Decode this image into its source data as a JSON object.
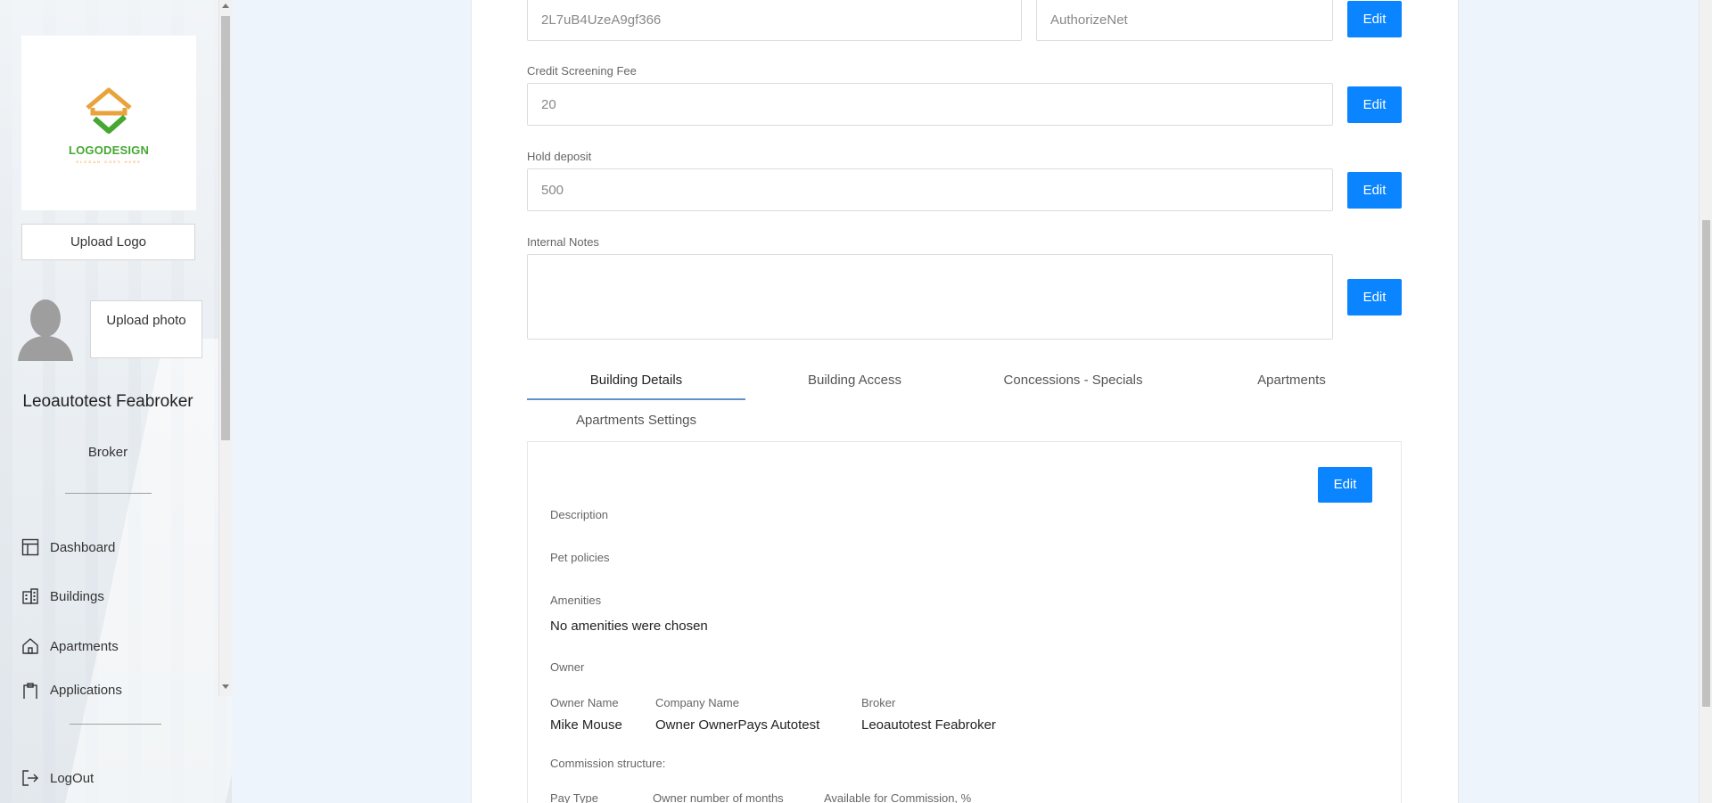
{
  "sidebar": {
    "logo_title": "LOGODESIGN",
    "logo_slogan": "SLOGAN GOES HERE",
    "upload_logo_label": "Upload Logo",
    "upload_photo_label": "Upload photo",
    "user_name": "Leoautotest Feabroker",
    "user_role": "Broker",
    "nav": {
      "dashboard": "Dashboard",
      "buildings": "Buildings",
      "apartments": "Apartments",
      "applications": "Applications",
      "logout": "LogOut"
    }
  },
  "form": {
    "gateway_key_value": "2L7uB4UzeA9gf366",
    "gateway_name_value": "AuthorizeNet",
    "credit_fee_label": "Credit Screening Fee",
    "credit_fee_value": "20",
    "hold_deposit_label": "Hold deposit",
    "hold_deposit_value": "500",
    "internal_notes_label": "Internal Notes",
    "internal_notes_value": "",
    "edit_label": "Edit"
  },
  "tabs": {
    "building_details": "Building Details",
    "building_access": "Building Access",
    "concessions": "Concessions - Specials",
    "apartments": "Apartments",
    "apartments_settings": "Apartments Settings"
  },
  "details": {
    "edit_label": "Edit",
    "description_label": "Description",
    "pet_policies_label": "Pet policies",
    "amenities_label": "Amenities",
    "amenities_value": "No amenities were chosen",
    "owner_section_label": "Owner",
    "owner_name_label": "Owner Name",
    "owner_name_value": "Mike Mouse",
    "company_name_label": "Company Name",
    "company_name_value": "Owner OwnerPays Autotest",
    "broker_label": "Broker",
    "broker_value": "Leoautotest Feabroker",
    "commission_label": "Commission structure:",
    "pay_type_label": "Pay Type",
    "owner_months_label": "Owner number of months",
    "available_commission_label": "Available for Commission, %"
  },
  "colors": {
    "accent": "#0a84ff",
    "page_bg": "#eef4fb",
    "logo_green": "#46a832",
    "logo_orange": "#e8a33b"
  }
}
